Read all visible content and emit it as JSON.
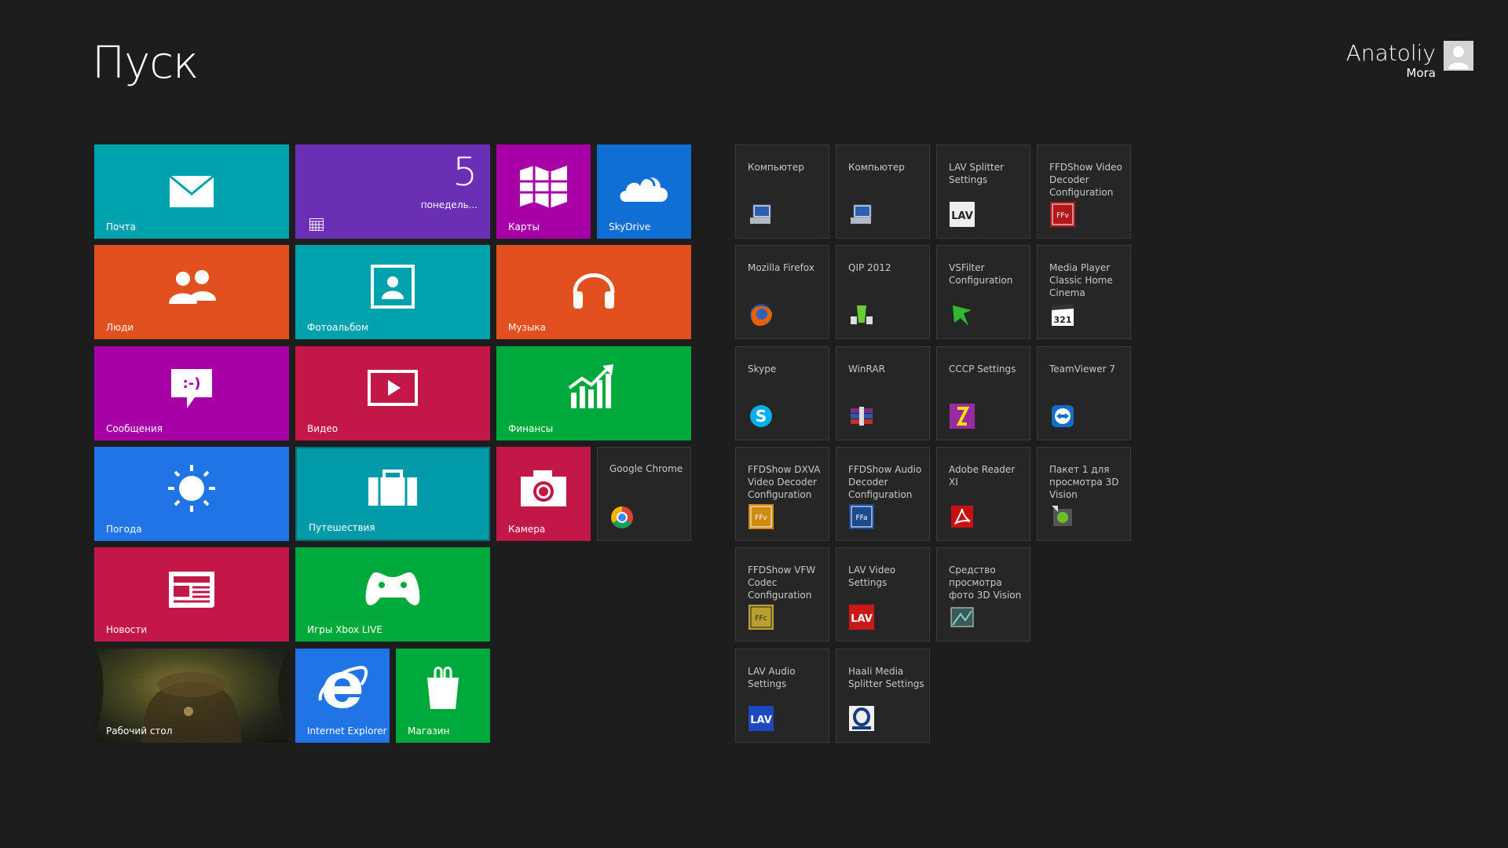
{
  "header": {
    "title": "Пуск"
  },
  "user": {
    "first_name": "Anatoliy",
    "last_name": "Mora"
  },
  "tiles": {
    "mail": {
      "label": "Почта",
      "color": "#00a3ad",
      "icon": "mail-icon"
    },
    "calendar": {
      "day": "5",
      "weekday": "понедель...",
      "color": "#6b2fb5",
      "icon": "calendar-icon"
    },
    "maps": {
      "label": "Карты",
      "color": "#a600a6",
      "icon": "map-icon"
    },
    "skydrive": {
      "label": "SkyDrive",
      "color": "#0f6fd4",
      "icon": "cloud-icon"
    },
    "people": {
      "label": "Люди",
      "color": "#e1501e",
      "icon": "people-icon"
    },
    "photos": {
      "label": "Фотоальбом",
      "color": "#00a3ad",
      "icon": "photo-icon"
    },
    "music": {
      "label": "Музыка",
      "color": "#e1501e",
      "icon": "headphones-icon"
    },
    "messaging": {
      "label": "Сообщения",
      "color": "#a600a6",
      "icon": "chat-icon"
    },
    "video": {
      "label": "Видео",
      "color": "#c31748",
      "icon": "play-icon"
    },
    "finance": {
      "label": "Финансы",
      "color": "#00a93c",
      "icon": "chart-icon"
    },
    "weather": {
      "label": "Погода",
      "color": "#2074e6",
      "icon": "sun-icon"
    },
    "travel": {
      "label": "Путешествия",
      "color": "#009aa8",
      "icon": "suitcase-icon"
    },
    "camera": {
      "label": "Камера",
      "color": "#c31748",
      "icon": "camera-icon"
    },
    "chrome": {
      "label": "Google Chrome",
      "color": "#262626",
      "icon": "chrome-icon"
    },
    "news": {
      "label": "Новости",
      "color": "#c31748",
      "icon": "newspaper-icon"
    },
    "xbox": {
      "label": "Игры Xbox LIVE",
      "color": "#00a93c",
      "icon": "gamepad-icon"
    },
    "desktop": {
      "label": "Рабочий стол",
      "color": "#3b3a25",
      "icon": "desktop-wallpaper"
    },
    "ie": {
      "label": "Internet Explorer",
      "color": "#2074e6",
      "icon": "ie-icon"
    },
    "store": {
      "label": "Магазин",
      "color": "#00a93c",
      "icon": "store-icon"
    }
  },
  "apps": [
    {
      "name": "Компьютер",
      "icon": "computer-icon"
    },
    {
      "name": "Компьютер",
      "icon": "computer-icon"
    },
    {
      "name": "LAV Splitter\nSettings",
      "icon": "lav-icon"
    },
    {
      "name": "FFDShow Video\nDecoder\nConfiguration",
      "icon": "ffdshow-icon"
    },
    {
      "name": "Mozilla Firefox",
      "icon": "firefox-icon"
    },
    {
      "name": "QIP 2012",
      "icon": "qip-icon"
    },
    {
      "name": "VSFilter\nConfiguration",
      "icon": "vsfilter-icon"
    },
    {
      "name": "Media Player\nClassic Home\nCinema",
      "icon": "mpc-icon"
    },
    {
      "name": "Skype",
      "icon": "skype-icon"
    },
    {
      "name": "WinRAR",
      "icon": "winrar-icon"
    },
    {
      "name": "CCCP Settings",
      "icon": "cccp-icon"
    },
    {
      "name": "TeamViewer 7",
      "icon": "teamviewer-icon"
    },
    {
      "name": "FFDShow DXVA\nVideo Decoder\nConfiguration",
      "icon": "ffdshow-dxva-icon"
    },
    {
      "name": "FFDShow Audio\nDecoder\nConfiguration",
      "icon": "ffdshow-audio-icon"
    },
    {
      "name": "Adobe Reader\nXI",
      "icon": "adobe-reader-icon"
    },
    {
      "name": "Пакет 1 для\nпросмотра 3D\nVision",
      "icon": "3d-vision-icon"
    },
    {
      "name": "FFDShow VFW\nCodec\nConfiguration",
      "icon": "ffdshow-vfw-icon"
    },
    {
      "name": "LAV Video\nSettings",
      "icon": "lav-video-icon"
    },
    {
      "name": "Средство\nпросмотра\nфото 3D Vision",
      "icon": "3d-photo-icon"
    },
    {
      "name": "LAV Audio\nSettings",
      "icon": "lav-audio-icon"
    },
    {
      "name": "Haali Media\nSplitter Settings",
      "icon": "haali-icon"
    }
  ]
}
